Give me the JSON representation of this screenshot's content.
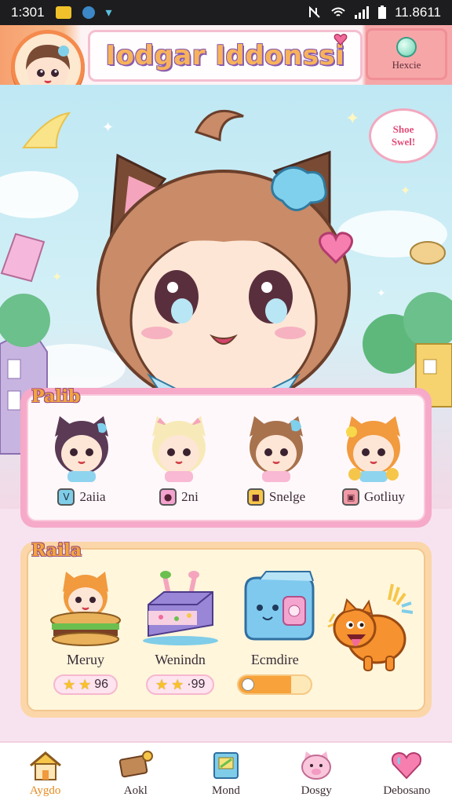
{
  "status_bar": {
    "time": "1:301",
    "clock": "11.8611"
  },
  "header": {
    "title": "Iodgar Iddonssi",
    "right_button_label": "Hexcie"
  },
  "scene": {
    "speech_bubble_lines": [
      "Shoe",
      "Swel!"
    ]
  },
  "pals_card": {
    "tag": "Palib",
    "pals": [
      {
        "name": "2aiia",
        "icon": "pal-icon-v",
        "icon_color": "#7fcde8",
        "hair": "#5a3a55"
      },
      {
        "name": "2ni",
        "icon": "pal-icon-pin",
        "icon_color": "#f4a3cf",
        "hair": "#f7eab8"
      },
      {
        "name": "Snelge",
        "icon": "pal-icon-box",
        "icon_color": "#f6c64a",
        "hair": "#a8724d"
      },
      {
        "name": "Gotliuy",
        "icon": "pal-icon-chest",
        "icon_color": "#f29aa6",
        "hair": "#f19a3e"
      }
    ]
  },
  "items_card": {
    "tag": "Raila",
    "items": [
      {
        "name": "Meruy",
        "art": "burger-cat-icon",
        "stars": 2,
        "rating": "96"
      },
      {
        "name": "Wenindn",
        "art": "cake-icon",
        "stars": 2,
        "rating": "·99"
      },
      {
        "name": "Ecmdire",
        "art": "blue-toaster-icon",
        "progress": 0.72
      },
      {
        "name": "",
        "art": "orange-dog-icon"
      }
    ]
  },
  "bottom_nav": [
    {
      "label": "Aygdo",
      "icon": "house-icon",
      "active": true
    },
    {
      "label": "Aokl",
      "icon": "sign-icon",
      "active": false
    },
    {
      "label": "Mond",
      "icon": "book-icon",
      "active": false
    },
    {
      "label": "Dosgy",
      "icon": "pig-face-icon",
      "active": false
    },
    {
      "label": "Debosano",
      "icon": "heart-icon",
      "active": false
    }
  ],
  "colors": {
    "accent_orange": "#f48a4c",
    "pink": "#f6a9c8",
    "sky": "#bfe8f4"
  }
}
